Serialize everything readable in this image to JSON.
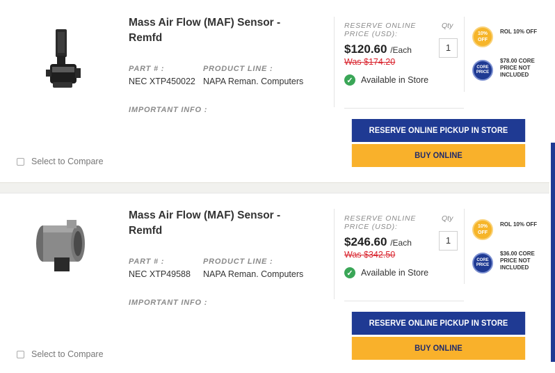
{
  "products": [
    {
      "title": "Mass Air Flow (MAF) Sensor - Remfd",
      "part_label": "PART # :",
      "part_number": "NEC XTP450022",
      "product_line_label": "PRODUCT LINE :",
      "product_line": "NAPA Reman. Computers",
      "important_info_label": "IMPORTANT INFO :",
      "compare_label": "Select to Compare",
      "reserve_price_label": "RESERVE ONLINE PRICE (USD):",
      "qty_label": "Qty",
      "qty_value": "1",
      "price": "$120.60",
      "price_unit": "/Each",
      "was_price": "Was $174.20",
      "availability": "Available in Store",
      "discount_badge": "10% OFF",
      "discount_text": "ROL 10% OFF",
      "core_badge": "CORE PRICE",
      "core_text": "$78.00 CORE PRICE NOT INCLUDED",
      "reserve_button": "RESERVE ONLINE PICKUP IN STORE",
      "buy_button": "BUY ONLINE"
    },
    {
      "title": "Mass Air Flow (MAF) Sensor - Remfd",
      "part_label": "PART # :",
      "part_number": "NEC XTP49588",
      "product_line_label": "PRODUCT LINE :",
      "product_line": "NAPA Reman. Computers",
      "important_info_label": "IMPORTANT INFO :",
      "compare_label": "Select to Compare",
      "reserve_price_label": "RESERVE ONLINE PRICE (USD):",
      "qty_label": "Qty",
      "qty_value": "1",
      "price": "$246.60",
      "price_unit": "/Each",
      "was_price": "Was $342.50",
      "availability": "Available in Store",
      "discount_badge": "10% OFF",
      "discount_text": "ROL 10% OFF",
      "core_badge": "CORE PRICE",
      "core_text": "$36.00 CORE PRICE NOT INCLUDED",
      "reserve_button": "RESERVE ONLINE PICKUP IN STORE",
      "buy_button": "BUY ONLINE"
    }
  ],
  "colors": {
    "navy": "#1f3a93",
    "yellow": "#f9b12b",
    "sale_red": "#d9232d",
    "available_green": "#3aa657"
  },
  "icons": [
    "checkbox-icon",
    "check-circle-icon",
    "discount-badge-icon",
    "core-price-badge-icon"
  ]
}
